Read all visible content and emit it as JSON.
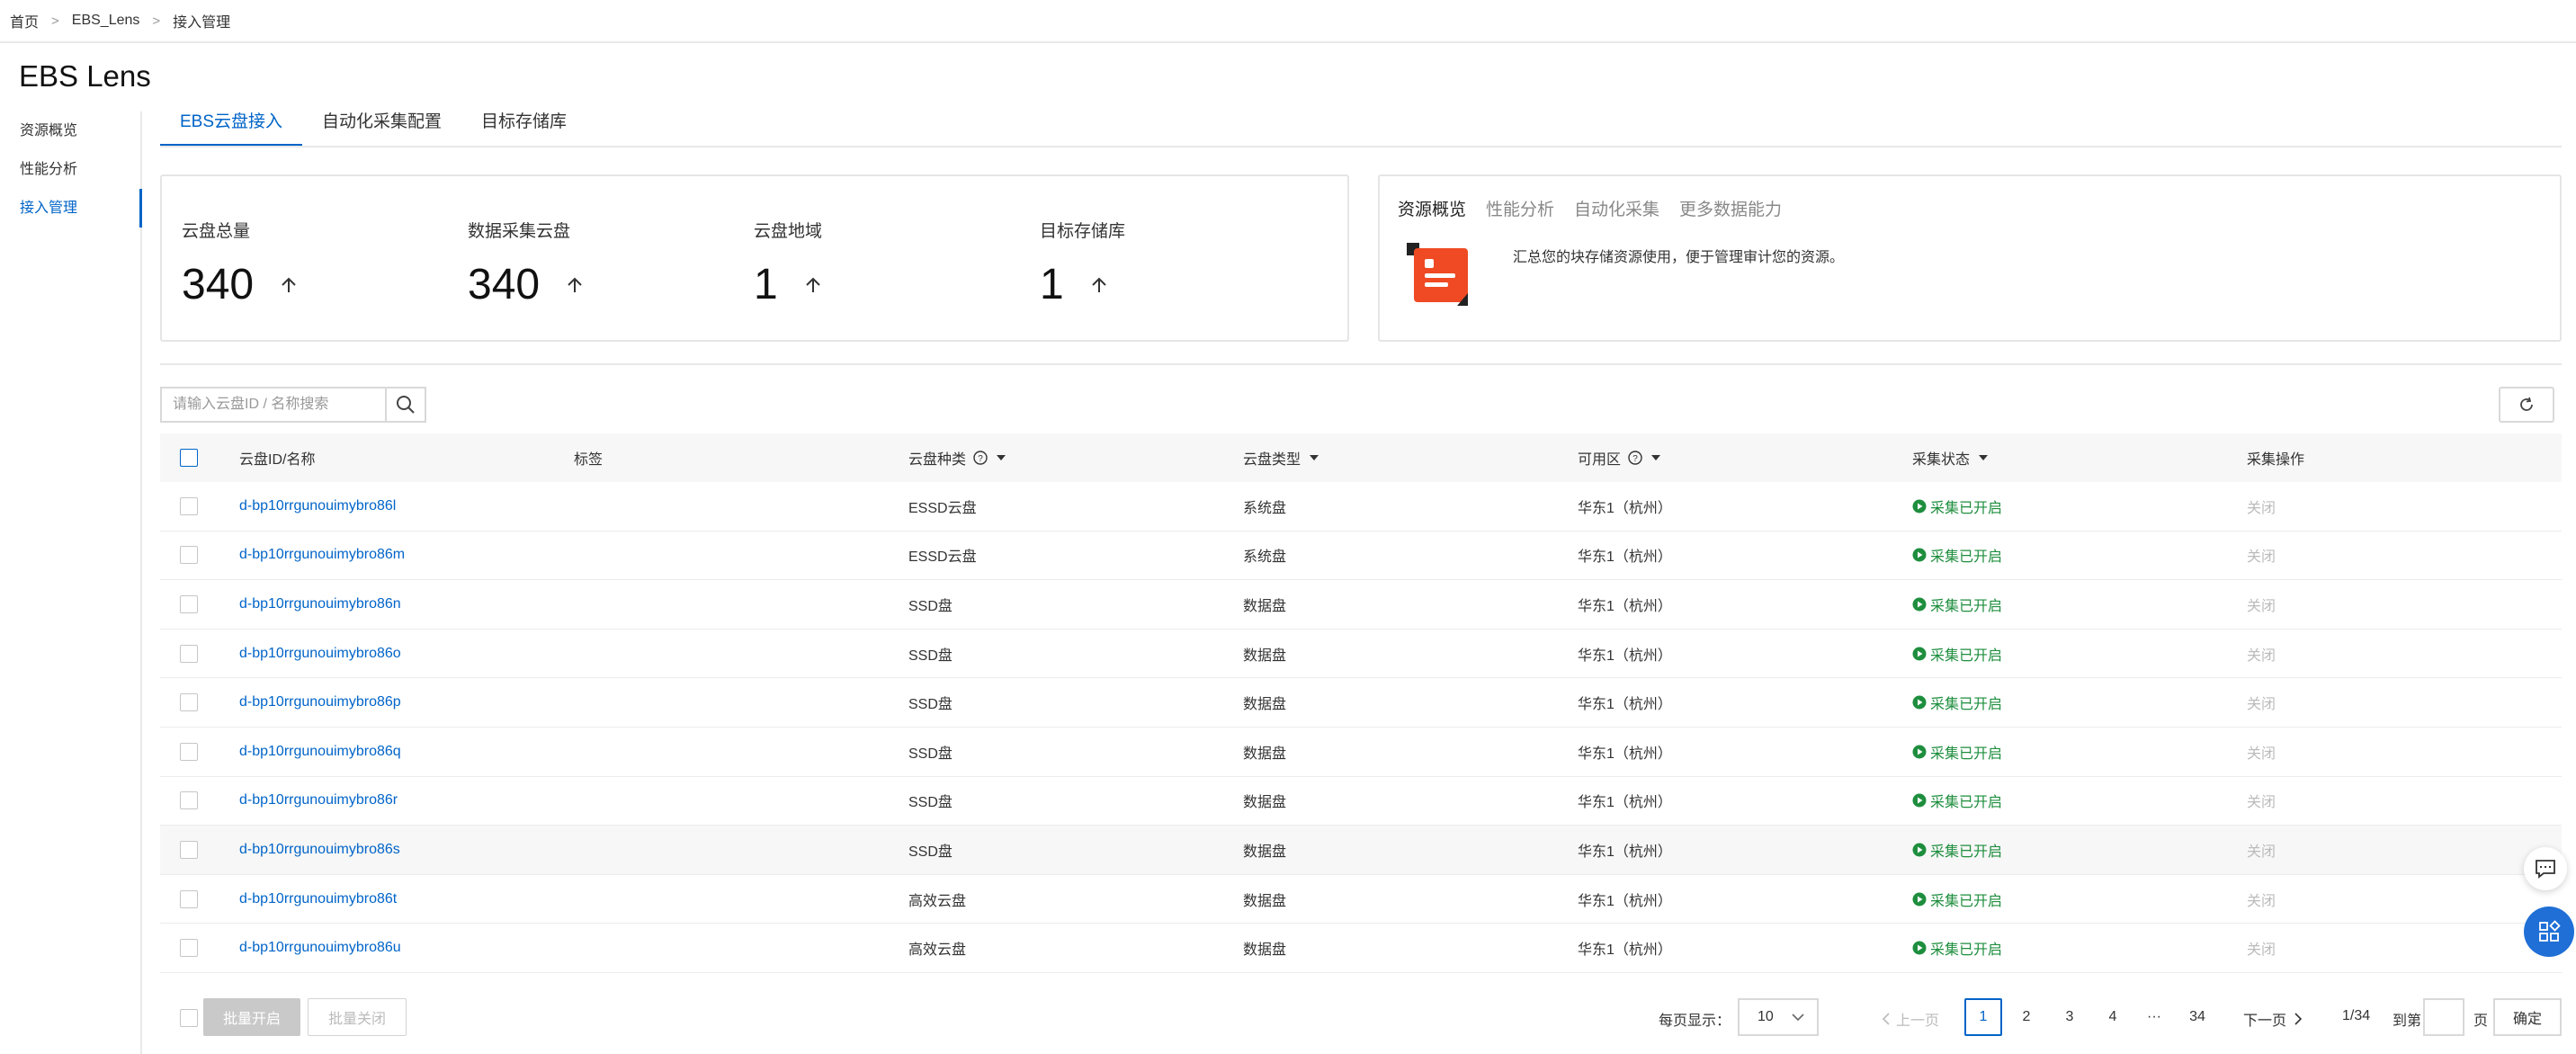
{
  "breadcrumb": {
    "home": "首页",
    "product": "EBS_Lens",
    "current": "接入管理"
  },
  "page_title": "EBS Lens",
  "sidebar": {
    "items": [
      {
        "label": "资源概览",
        "active": false
      },
      {
        "label": "性能分析",
        "active": false
      },
      {
        "label": "接入管理",
        "active": true
      }
    ]
  },
  "tabs": [
    {
      "label": "EBS云盘接入",
      "active": true
    },
    {
      "label": "自动化采集配置",
      "active": false
    },
    {
      "label": "目标存储库",
      "active": false
    }
  ],
  "stats": [
    {
      "label": "云盘总量",
      "value": "340"
    },
    {
      "label": "数据采集云盘",
      "value": "340"
    },
    {
      "label": "云盘地域",
      "value": "1"
    },
    {
      "label": "目标存储库",
      "value": "1"
    }
  ],
  "info_card": {
    "tabs": [
      "资源概览",
      "性能分析",
      "自动化采集",
      "更多数据能力"
    ],
    "description": "汇总您的块存储资源使用，便于管理审计您的资源。"
  },
  "search": {
    "placeholder": "请输入云盘ID / 名称搜索"
  },
  "table": {
    "headers": {
      "id": "云盘ID/名称",
      "tag": "标签",
      "kind": "云盘种类",
      "type": "云盘类型",
      "zone": "可用区",
      "status": "采集状态",
      "op": "采集操作"
    },
    "rows": [
      {
        "id": "d-bp10rrgunouimybro86l",
        "kind": "ESSD云盘",
        "type": "系统盘",
        "zone": "华东1（杭州）",
        "status": "采集已开启",
        "op": "关闭"
      },
      {
        "id": "d-bp10rrgunouimybro86m",
        "kind": "ESSD云盘",
        "type": "系统盘",
        "zone": "华东1（杭州）",
        "status": "采集已开启",
        "op": "关闭"
      },
      {
        "id": "d-bp10rrgunouimybro86n",
        "kind": "SSD盘",
        "type": "数据盘",
        "zone": "华东1（杭州）",
        "status": "采集已开启",
        "op": "关闭"
      },
      {
        "id": "d-bp10rrgunouimybro86o",
        "kind": "SSD盘",
        "type": "数据盘",
        "zone": "华东1（杭州）",
        "status": "采集已开启",
        "op": "关闭"
      },
      {
        "id": "d-bp10rrgunouimybro86p",
        "kind": "SSD盘",
        "type": "数据盘",
        "zone": "华东1（杭州）",
        "status": "采集已开启",
        "op": "关闭"
      },
      {
        "id": "d-bp10rrgunouimybro86q",
        "kind": "SSD盘",
        "type": "数据盘",
        "zone": "华东1（杭州）",
        "status": "采集已开启",
        "op": "关闭"
      },
      {
        "id": "d-bp10rrgunouimybro86r",
        "kind": "SSD盘",
        "type": "数据盘",
        "zone": "华东1（杭州）",
        "status": "采集已开启",
        "op": "关闭"
      },
      {
        "id": "d-bp10rrgunouimybro86s",
        "kind": "SSD盘",
        "type": "数据盘",
        "zone": "华东1（杭州）",
        "status": "采集已开启",
        "op": "关闭"
      },
      {
        "id": "d-bp10rrgunouimybro86t",
        "kind": "高效云盘",
        "type": "数据盘",
        "zone": "华东1（杭州）",
        "status": "采集已开启",
        "op": "关闭"
      },
      {
        "id": "d-bp10rrgunouimybro86u",
        "kind": "高效云盘",
        "type": "数据盘",
        "zone": "华东1（杭州）",
        "status": "采集已开启",
        "op": "关闭"
      }
    ]
  },
  "footer": {
    "batch_open": "批量开启",
    "batch_close": "批量关闭",
    "page_size_label": "每页显示：",
    "page_size": "10",
    "prev": "上一页",
    "next": "下一页",
    "pages": [
      "1",
      "2",
      "3",
      "4"
    ],
    "ellipsis": "···",
    "last_page": "34",
    "total": "1/34",
    "goto_label": "到第",
    "page_suffix": "页",
    "confirm": "确定"
  },
  "colors": {
    "accent": "#0064c8",
    "status_green": "#1e8e3e",
    "icon_orange": "#ef4a23"
  },
  "icons": [
    "chevron-right-icon",
    "arrow-up-icon",
    "search-icon",
    "refresh-icon",
    "help-icon",
    "sort-caret-icon",
    "play-circle-icon",
    "chevron-down-icon",
    "chevron-left-icon",
    "chat-icon",
    "apps-icon",
    "document-illustration-icon"
  ]
}
